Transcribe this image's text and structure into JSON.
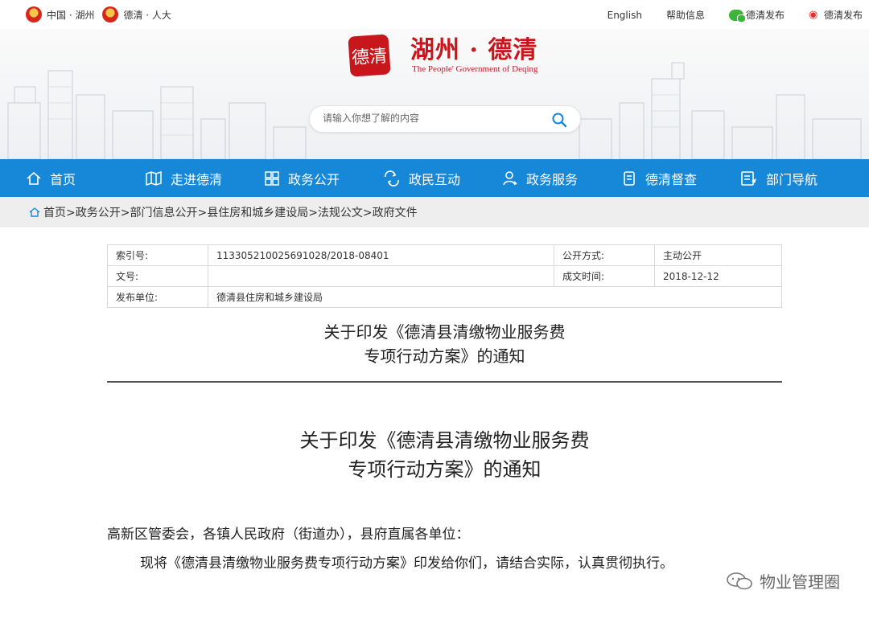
{
  "topbar": {
    "left_links": [
      "中国 · 湖州",
      "德清 · 人大"
    ],
    "right_links": [
      "English",
      "帮助信息",
      "德清发布",
      "德清发布"
    ]
  },
  "header": {
    "logo_seal": "德清",
    "logo_cn": "湖州 · 德清",
    "logo_en": "The People' Government of Deqing"
  },
  "search": {
    "placeholder": "请输入你想了解的内容"
  },
  "nav": {
    "items": [
      {
        "label": "首页",
        "icon": "home-icon"
      },
      {
        "label": "走进德清",
        "icon": "map-icon"
      },
      {
        "label": "政务公开",
        "icon": "grid-icon"
      },
      {
        "label": "政民互动",
        "icon": "interaction-icon"
      },
      {
        "label": "政务服务",
        "icon": "user-icon"
      },
      {
        "label": "德清督查",
        "icon": "inspect-icon"
      },
      {
        "label": "部门导航",
        "icon": "guide-icon"
      }
    ]
  },
  "breadcrumb": "首页>政务公开>部门信息公开>县住房和城乡建设局>法规公文>政府文件",
  "info_table": {
    "index_label": "索引号:",
    "index_value": "113305210025691028/2018-08401",
    "open_label": "公开方式:",
    "open_value": "主动公开",
    "docno_label": "文号:",
    "docno_value": "",
    "date_label": "成文时间:",
    "date_value": "2018-12-12",
    "issuer_label": "发布单位:",
    "issuer_value": "德清县住房和城乡建设局"
  },
  "document": {
    "title_line1": "关于印发《德清县清缴物业服务费",
    "title_line2": "专项行动方案》的通知",
    "addressee": "高新区管委会，各镇人民政府（街道办），县府直属各单位：",
    "paragraph": "现将《德清县清缴物业服务费专项行动方案》印发给你们，请结合实际，认真贯彻执行。"
  },
  "watermark": "物业管理圈",
  "colors": {
    "nav": "#1787d8",
    "brand_red": "#c8161d"
  }
}
